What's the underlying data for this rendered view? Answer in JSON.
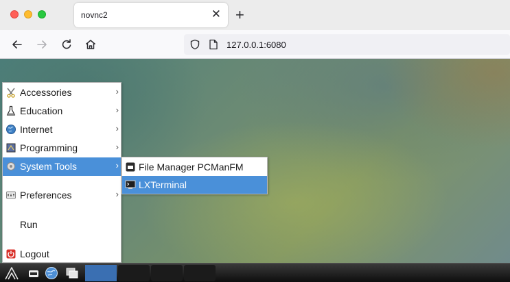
{
  "browser": {
    "tab_title": "novnc2",
    "tab_close_glyph": "✕",
    "new_tab_glyph": "+",
    "url": "127.0.0.1:6080",
    "nav_icons": [
      "back-arrow-icon",
      "forward-arrow-icon",
      "reload-icon",
      "home-icon"
    ],
    "url_icons": [
      "shield-icon",
      "page-icon"
    ]
  },
  "start_menu": {
    "items": [
      {
        "label": "Accessories",
        "icon": "accessories-icon",
        "has_submenu": true,
        "arrow": "›"
      },
      {
        "label": "Education",
        "icon": "flask-icon",
        "has_submenu": true,
        "arrow": "›"
      },
      {
        "label": "Internet",
        "icon": "globe-icon",
        "has_submenu": true,
        "arrow": "›"
      },
      {
        "label": "Programming",
        "icon": "programming-icon",
        "has_submenu": true,
        "arrow": "›"
      },
      {
        "label": "System Tools",
        "icon": "gear-icon",
        "has_submenu": true,
        "arrow": "›",
        "active": true
      },
      {
        "label": "Preferences",
        "icon": "preferences-icon",
        "has_submenu": true,
        "arrow": "›"
      },
      {
        "label": "Run",
        "icon": "",
        "has_submenu": false
      },
      {
        "label": "Logout",
        "icon": "logout-icon",
        "has_submenu": false
      }
    ]
  },
  "submenu": {
    "items": [
      {
        "label": "File Manager PCManFM",
        "icon": "file-manager-icon"
      },
      {
        "label": "LXTerminal",
        "icon": "terminal-icon",
        "active": true
      }
    ]
  },
  "taskbar": {
    "icons": [
      "menu-logo-icon",
      "show-desktop-icon",
      "browser-globe-icon",
      "windows-icon"
    ]
  },
  "colors": {
    "highlight": "#4a90d9",
    "taskbar": "#1b1b1b"
  }
}
